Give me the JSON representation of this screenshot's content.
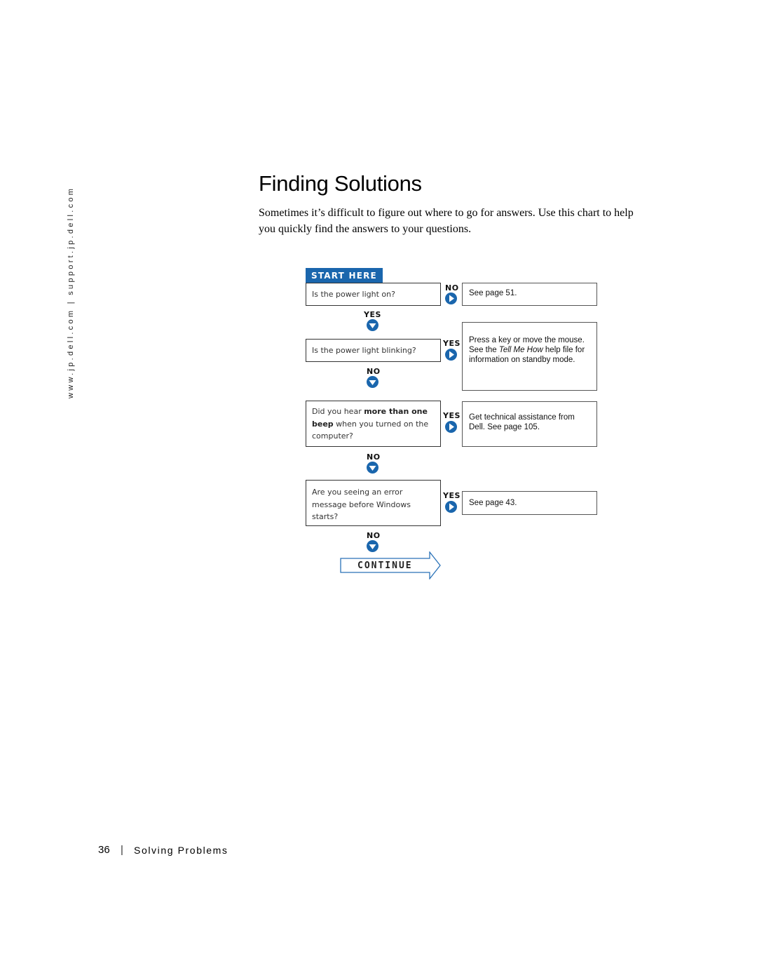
{
  "sidebar": {
    "url_text": "www.jp.dell.com | support.jp.dell.com"
  },
  "header": {
    "title": "Finding Solutions",
    "intro": "Sometimes it’s difficult to figure out where to go for answers. Use this chart to help you quickly find the answers to your questions."
  },
  "flowchart": {
    "start_label": "START HERE",
    "continue_label": "CONTINUE",
    "accent_color": "#1a66ad",
    "questions": [
      {
        "text": "Is the power light on?"
      },
      {
        "text": "Is the power light blinking?"
      },
      {
        "text_before": "Did you hear ",
        "text_bold1": "more than one",
        "text_bold2": "beep",
        "text_after": " when you turned on the computer?"
      },
      {
        "text": "Are you seeing an error message before Windows starts?"
      }
    ],
    "connectors": {
      "q1_right": "NO",
      "q1_down": "YES",
      "q2_right": "YES",
      "q2_down": "NO",
      "q3_right": "YES",
      "q3_down": "NO",
      "q4_right": "YES",
      "q4_down": "NO"
    },
    "answers": {
      "a1": "See page 51.",
      "a2_part1": "Press a key or move the mouse. See the ",
      "a2_italic": "Tell Me How",
      "a2_part2": " help file for information on standby mode.",
      "a3": "Get technical assistance from Dell. See page 105.",
      "a4": "See page 43."
    }
  },
  "footer": {
    "page_number": "36",
    "separator": "|",
    "section_title": "Solving Problems"
  }
}
